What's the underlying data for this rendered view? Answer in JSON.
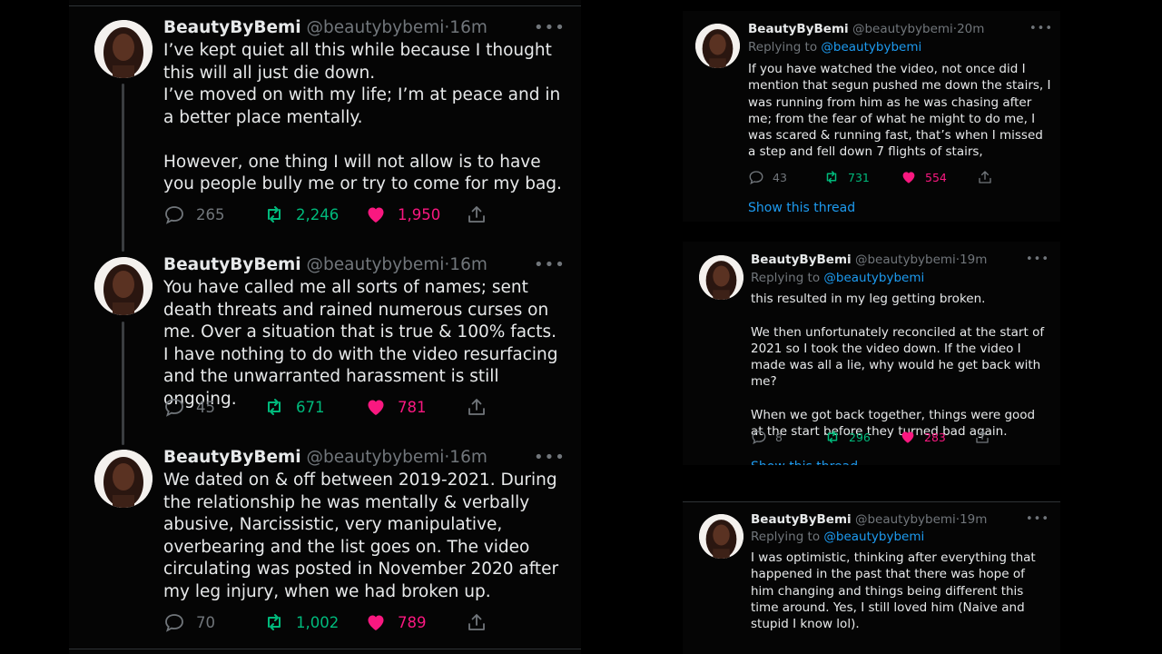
{
  "colors": {
    "background": "#000000",
    "text": "#e7e9ea",
    "muted": "#71767b",
    "link": "#1d9bf0",
    "retweet": "#00ba7c",
    "like": "#f91880"
  },
  "icons": {
    "reply": "reply-icon",
    "retweet": "retweet-icon",
    "like": "heart-icon",
    "share": "share-icon",
    "more": "more-icon"
  },
  "left_tweets": [
    {
      "name": "BeautyByBemi",
      "handle": "@beautybybemi",
      "dot": "·",
      "time": "16m",
      "more": "•••",
      "text": "I’ve kept quiet all this while because I thought this will all just die down.\nI’ve moved on with my life; I’m at peace and in a better place mentally.\n\nHowever, one thing I will not allow is to have you people bully me or try to come for my bag.",
      "replies": "265",
      "retweets": "2,246",
      "likes": "1,950"
    },
    {
      "name": "BeautyByBemi",
      "handle": "@beautybybemi",
      "dot": "·",
      "time": "16m",
      "more": "•••",
      "text": "You have called me all sorts of names; sent death threats and rained numerous curses on me. Over a situation that is true & 100% facts. I have nothing to do with the video resurfacing and the unwarranted harassment is still ongoing.",
      "replies": "45",
      "retweets": "671",
      "likes": "781"
    },
    {
      "name": "BeautyByBemi",
      "handle": "@beautybybemi",
      "dot": "·",
      "time": "16m",
      "more": "•••",
      "text": "We dated on & off between 2019-2021. During the relationship he was mentally & verbally abusive, Narcissistic, very manipulative, overbearing and the list goes on. The video circulating was posted in November 2020 after my leg injury, when we had broken up.",
      "replies": "70",
      "retweets": "1,002",
      "likes": "789"
    }
  ],
  "right_tweets": [
    {
      "name": "BeautyByBemi",
      "handle": "@beautybybemi",
      "dot": "·",
      "time": "20m",
      "more": "•••",
      "replying_prefix": "Replying to",
      "replying_to": "@beautybybemi",
      "text": "If you have watched the video, not once did I mention that segun pushed me down the stairs, I was running from him as he was chasing after me; from the fear of what he might to do me, I was scared & running fast, that’s when I missed a step and fell down 7 flights of stairs,",
      "replies": "43",
      "retweets": "731",
      "likes": "554",
      "show_thread": "Show this thread"
    },
    {
      "name": "BeautyByBemi",
      "handle": "@beautybybemi",
      "dot": "·",
      "time": "19m",
      "more": "•••",
      "replying_prefix": "Replying to",
      "replying_to": "@beautybybemi",
      "text": "this resulted in my leg getting broken.\n\nWe then unfortunately reconciled at the start of 2021 so I took the video down. If the video I made was all a lie, why would he get back with me?\n\nWhen we got back together, things were good at the start before they turned bad again.",
      "replies": "8",
      "retweets": "296",
      "likes": "283",
      "show_thread": "Show this thread"
    },
    {
      "name": "BeautyByBemi",
      "handle": "@beautybybemi",
      "dot": "·",
      "time": "19m",
      "more": "•••",
      "replying_prefix": "Replying to",
      "replying_to": "@beautybybemi",
      "text": "I was optimistic, thinking after everything that happened in the past that there was hope of him changing and things being different this time around. Yes, I still loved him (Naive and stupid I know lol)."
    }
  ]
}
